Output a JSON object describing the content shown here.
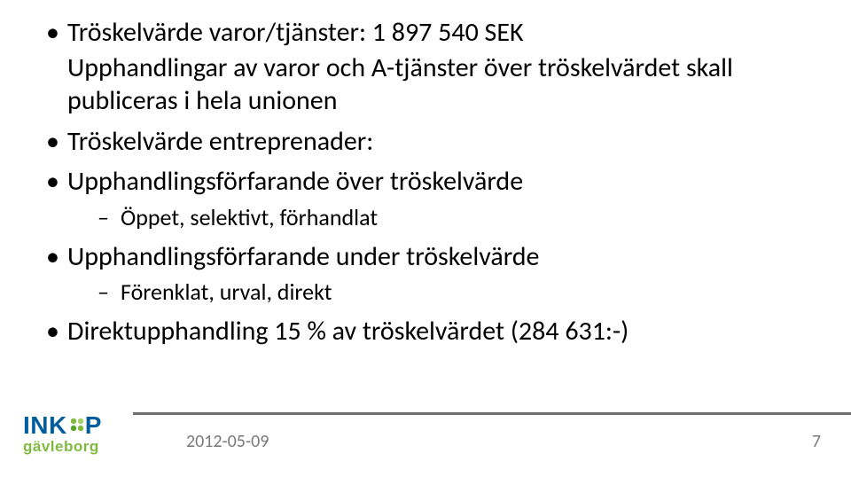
{
  "bullets": {
    "b1": {
      "title": "Tröskelvärde varor/tjänster: 1 897 540 SEK",
      "sub": "Upphandlingar av varor och A-tjänster över tröskelvärdet skall publiceras i hela unionen"
    },
    "b2": {
      "title": "Tröskelvärde entreprenader:"
    },
    "b3": {
      "title": "Upphandlingsförfarande över tröskelvärde",
      "dash": "Öppet, selektivt, förhandlat"
    },
    "b4": {
      "title": "Upphandlingsförfarande under tröskelvärde",
      "dash": "Förenklat, urval, direkt"
    },
    "b5": {
      "title": "Direktupphandling 15 % av tröskelvärdet (284 631:-)"
    }
  },
  "footer": {
    "date": "2012-05-09",
    "page": "7"
  },
  "logo": {
    "line1": "INK",
    "line1b": "P",
    "line2": "gävleborg"
  }
}
